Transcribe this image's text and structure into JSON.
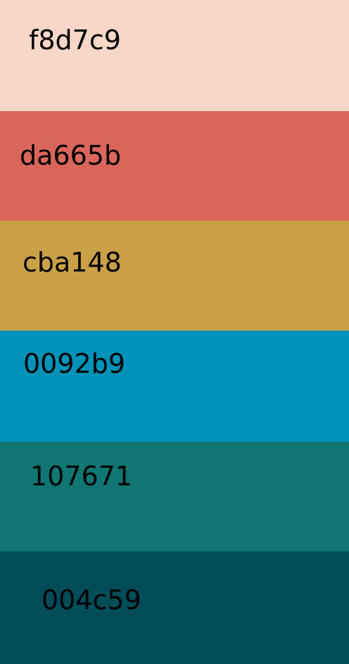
{
  "swatches": [
    {
      "label": "f8d7c9",
      "color": "#f8d7c9"
    },
    {
      "label": "da665b",
      "color": "#da665b"
    },
    {
      "label": "cba148",
      "color": "#cba148"
    },
    {
      "label": "0092b9",
      "color": "#0092b9"
    },
    {
      "label": "107671",
      "color": "#107671"
    },
    {
      "label": "004c59",
      "color": "#004c59"
    }
  ]
}
